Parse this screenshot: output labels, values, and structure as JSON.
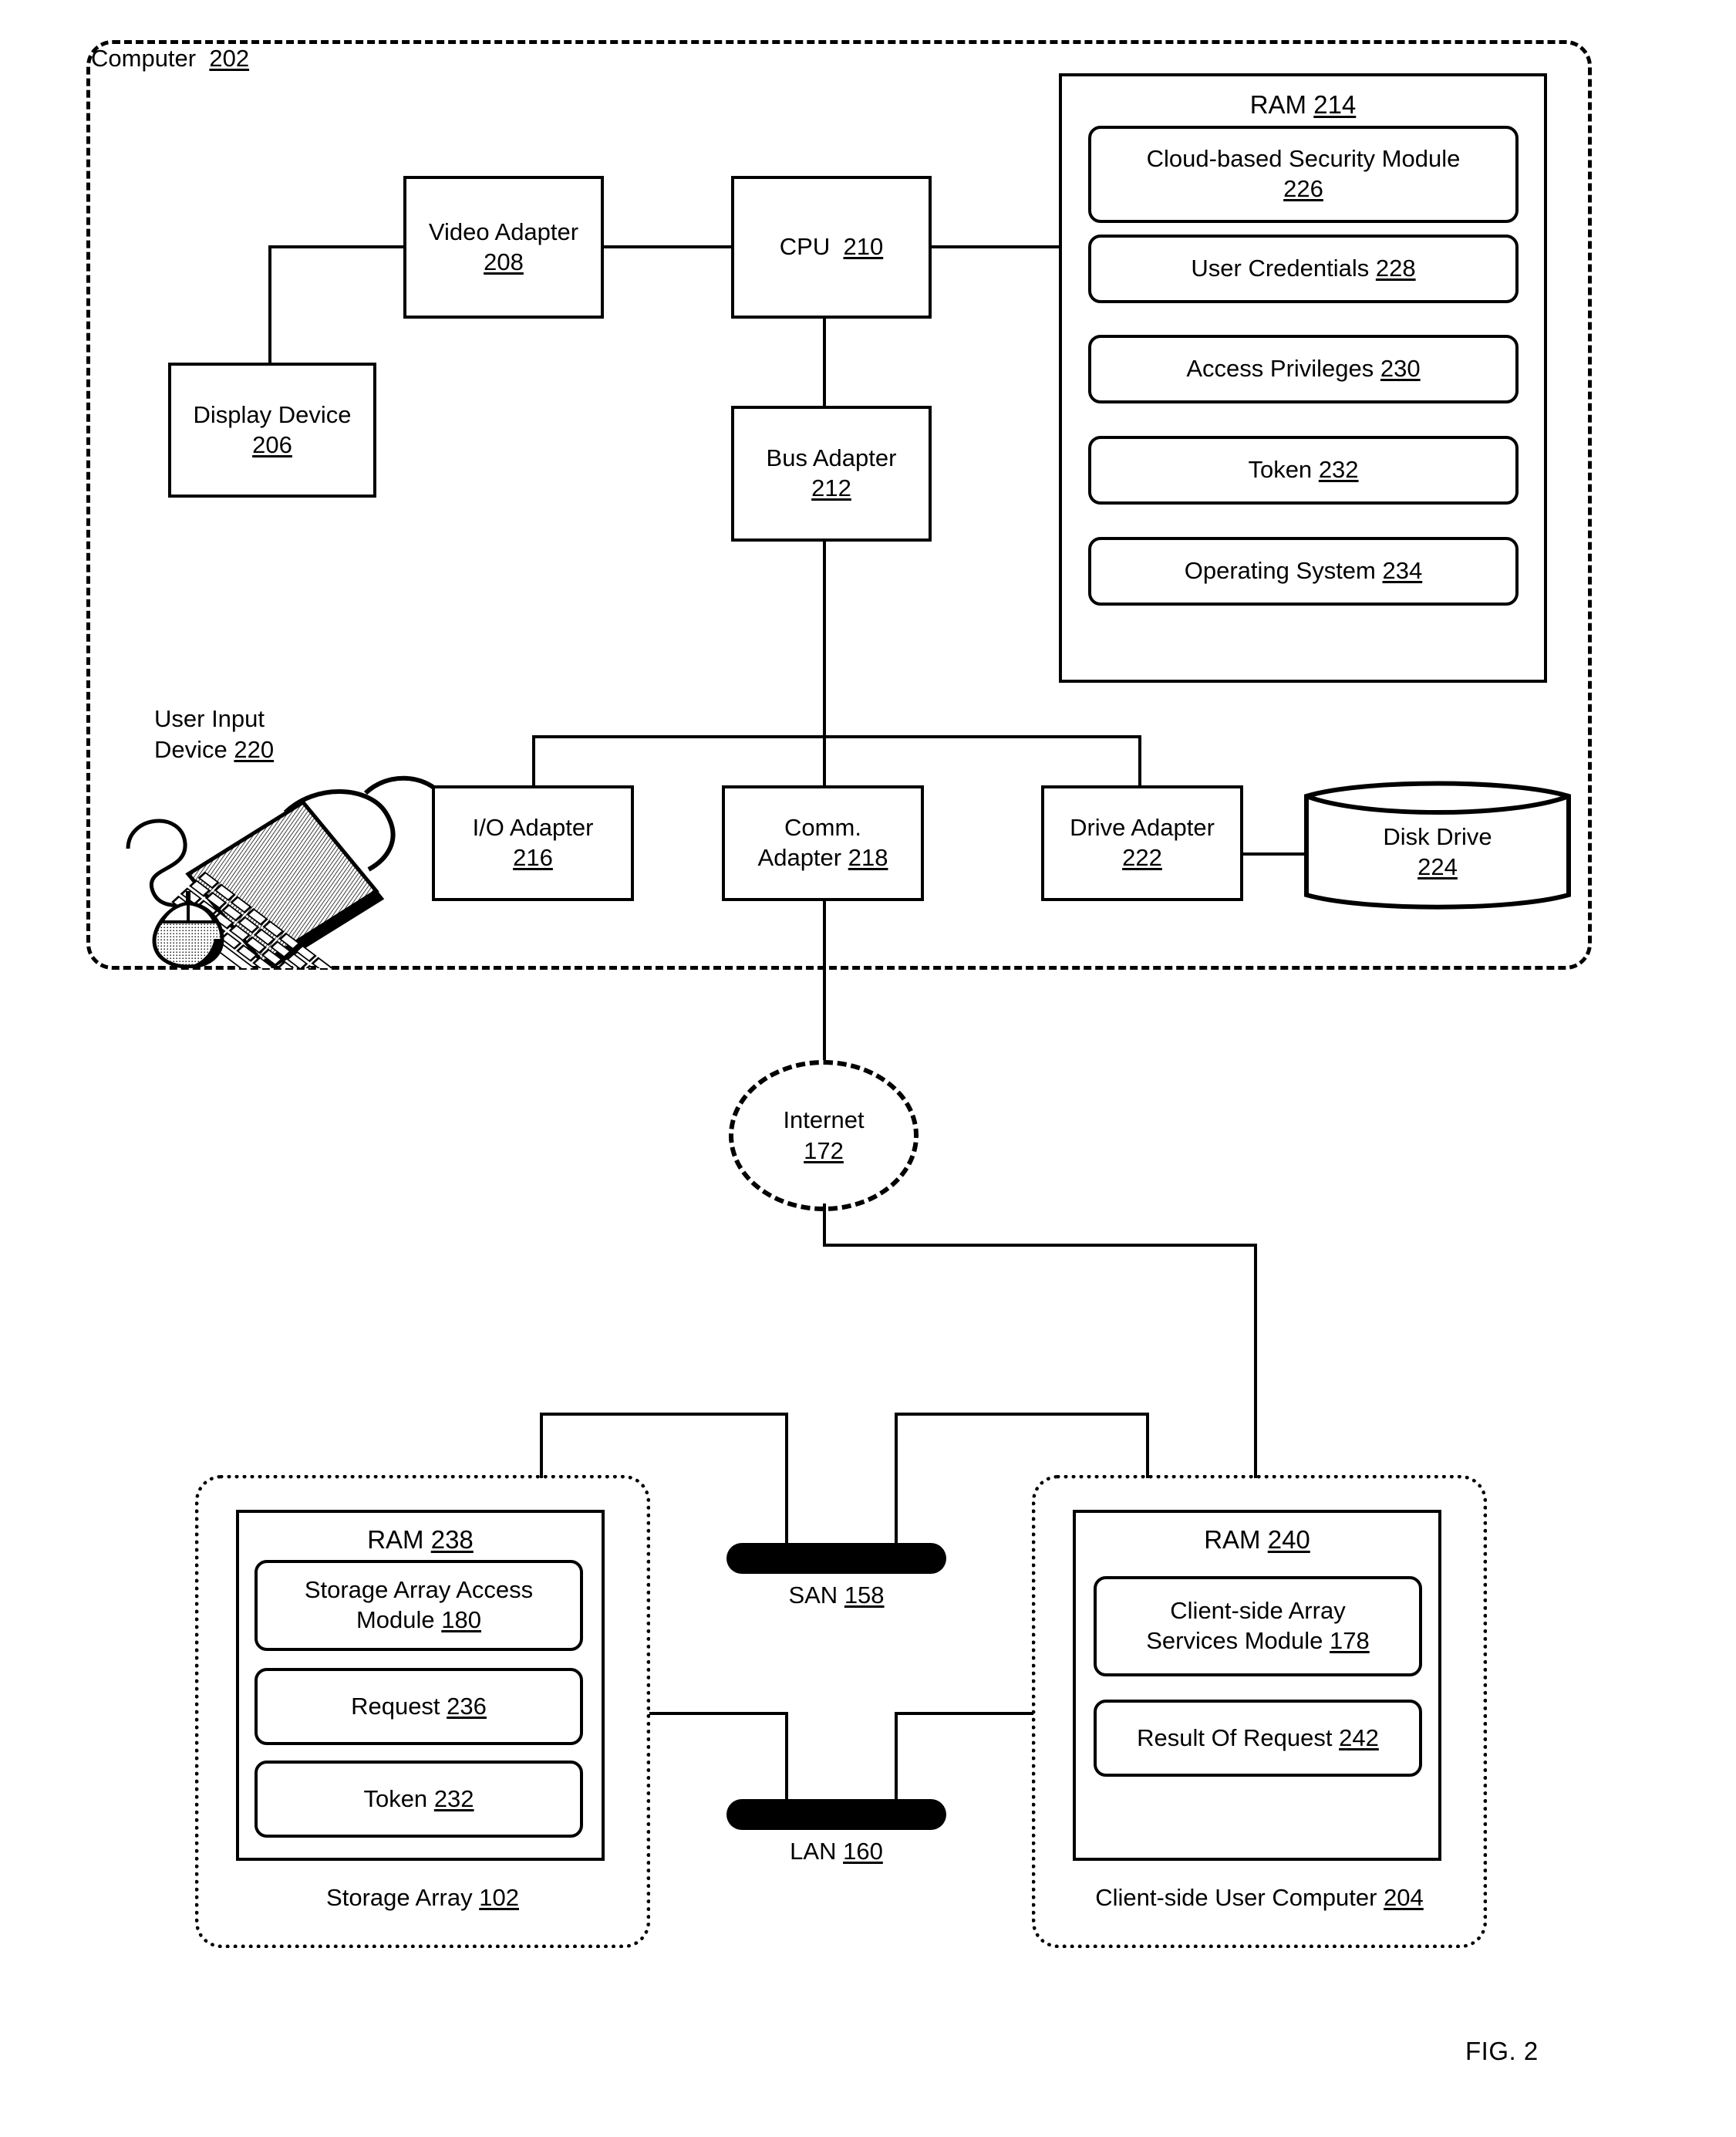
{
  "figure": {
    "caption": "FIG. 2"
  },
  "computer": {
    "title_text": "Computer",
    "title_num": "202",
    "video_adapter": {
      "line1": "Video Adapter",
      "num": "208"
    },
    "display_device": {
      "line1": "Display Device",
      "num": "206"
    },
    "cpu": {
      "line1": "CPU",
      "num": "210"
    },
    "bus_adapter": {
      "line1": "Bus Adapter",
      "num": "212"
    },
    "user_input_device": {
      "line1": "User Input",
      "line2": "Device",
      "num": "220"
    },
    "io_adapter": {
      "line1": "I/O Adapter",
      "num": "216"
    },
    "comm_adapter": {
      "line1": "Comm.",
      "line2": "Adapter",
      "num": "218"
    },
    "drive_adapter": {
      "line1": "Drive Adapter",
      "num": "222"
    },
    "disk_drive": {
      "line1": "Disk Drive",
      "num": "224"
    },
    "ram": {
      "title_text": "RAM",
      "title_num": "214",
      "modules": [
        {
          "label": "Cloud-based Security Module",
          "num": "226",
          "two_line": true
        },
        {
          "label": "User Credentials",
          "num": "228",
          "two_line": false
        },
        {
          "label": "Access Privileges",
          "num": "230",
          "two_line": false
        },
        {
          "label": "Token",
          "num": "232",
          "two_line": false
        },
        {
          "label": "Operating System",
          "num": "234",
          "two_line": false
        }
      ]
    }
  },
  "internet": {
    "label": "Internet",
    "num": "172"
  },
  "san": {
    "label": "SAN",
    "num": "158"
  },
  "lan": {
    "label": "LAN",
    "num": "160"
  },
  "storage_array": {
    "title_text": "Storage Array",
    "title_num": "102",
    "ram": {
      "title_text": "RAM",
      "title_num": "238",
      "modules": [
        {
          "label": "Storage Array Access",
          "label2": "Module",
          "num": "180",
          "two_line": true
        },
        {
          "label": "Request",
          "num": "236",
          "two_line": false
        },
        {
          "label": "Token",
          "num": "232",
          "two_line": false
        }
      ]
    }
  },
  "client_computer": {
    "title_text": "Client-side User Computer",
    "title_num": "204",
    "ram": {
      "title_text": "RAM",
      "title_num": "240",
      "modules": [
        {
          "label": "Client-side Array",
          "label2": "Services Module",
          "num": "178",
          "two_line": true
        },
        {
          "label": "Result Of Request",
          "num": "242",
          "two_line": false
        }
      ]
    }
  }
}
